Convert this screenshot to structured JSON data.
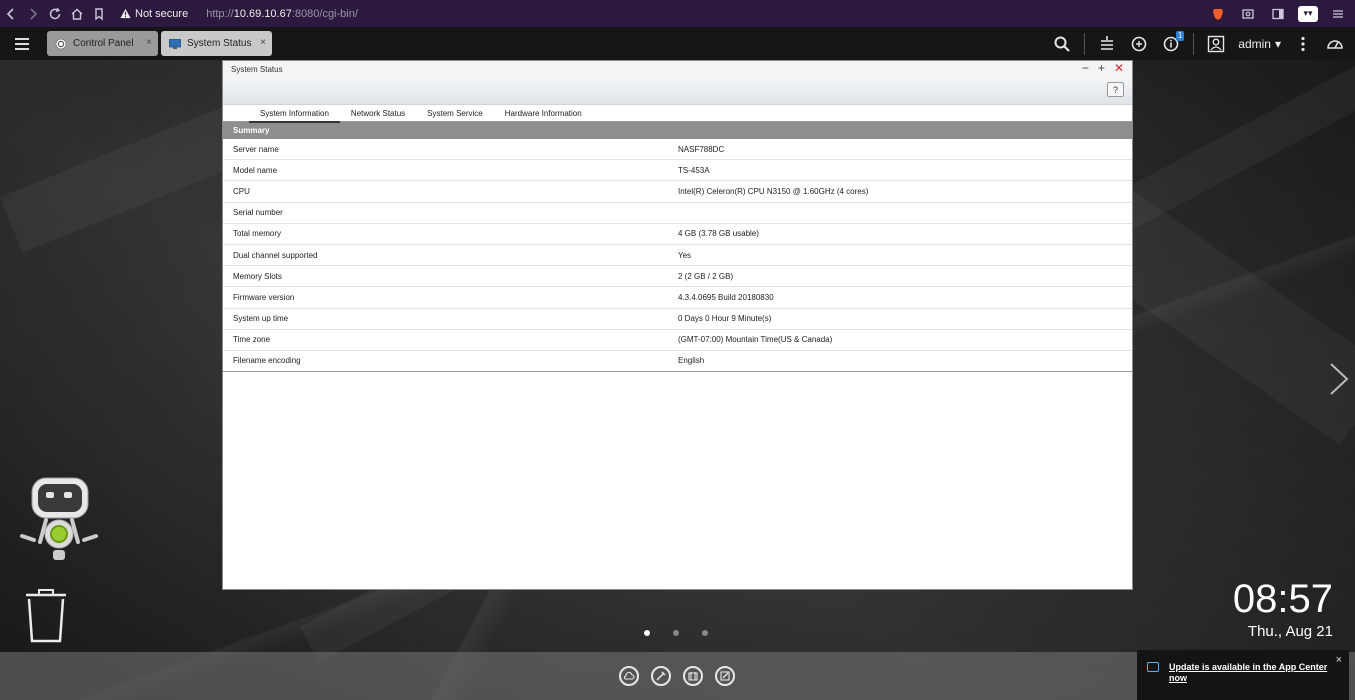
{
  "browser": {
    "not_secure": "Not secure",
    "url_prefix": "http://",
    "url_host": "10.69.10.67",
    "url_rest": ":8080/cgi-bin/"
  },
  "taskbar": {
    "tabs": [
      {
        "label": "Control Panel",
        "close": "×"
      },
      {
        "label": "System Status",
        "close": "×"
      }
    ],
    "notification_count": "1",
    "user": "admin"
  },
  "window": {
    "title": "System Status",
    "help": "?",
    "tabs": [
      "System Information",
      "Network Status",
      "System Service",
      "Hardware Information"
    ],
    "section": "Summary",
    "rows": [
      {
        "label": "Server name",
        "value": "NASF788DC"
      },
      {
        "label": "Model name",
        "value": "TS-453A"
      },
      {
        "label": "CPU",
        "value": "Intel(R) Celeron(R) CPU N3150 @ 1.60GHz (4 cores)"
      },
      {
        "label": "Serial number",
        "value": ""
      },
      {
        "label": "Total memory",
        "value": "4 GB (3.78 GB usable)"
      },
      {
        "label": "Dual channel supported",
        "value": "Yes"
      },
      {
        "label": "Memory Slots",
        "value": "2 (2 GB / 2 GB)"
      },
      {
        "label": "Firmware version",
        "value": "4.3.4.0695 Build 20180830"
      },
      {
        "label": "System up time",
        "value": "0 Days 0 Hour 9 Minute(s)"
      },
      {
        "label": "Time zone",
        "value": "(GMT-07:00) Mountain Time(US & Canada)"
      },
      {
        "label": "Filename encoding",
        "value": "English"
      }
    ]
  },
  "clock": {
    "time": "08:57",
    "date": "Thu., Aug 21"
  },
  "notice": {
    "text": "Update is available in the App Center now",
    "close": "×"
  },
  "colors": {
    "browser_bg": "#2b1a3d",
    "taskbar_bg": "#161616",
    "summary_bg": "#8e8e8e",
    "close_red": "#d0282a",
    "badge_blue": "#2a7fd4"
  }
}
